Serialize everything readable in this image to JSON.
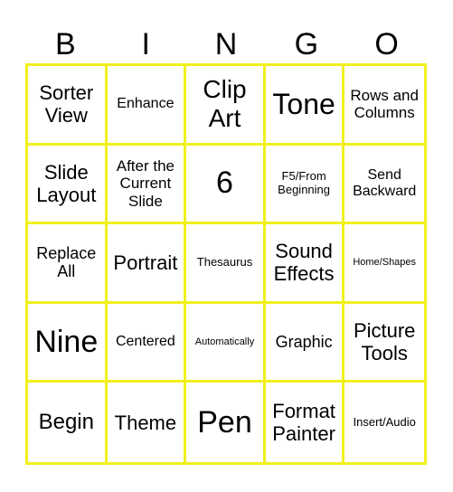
{
  "header": {
    "letters": [
      "B",
      "I",
      "N",
      "G",
      "O"
    ]
  },
  "colors": {
    "grid_border": "#f0f01e",
    "background": "#ffffff",
    "text": "#000000"
  },
  "cells": [
    "Sorter View",
    "Enhance",
    "Clip Art",
    "Tone",
    "Rows and Columns",
    "Slide Layout",
    "After the Current Slide",
    "6",
    "F5/From Beginning",
    "Send Backward",
    "Replace All",
    "Portrait",
    "Thesaurus",
    "Sound Effects",
    "Home/Shapes",
    "Nine",
    "Centered",
    "Automatically",
    "Graphic",
    "Picture Tools",
    "Begin",
    "Theme",
    "Pen",
    "Format Painter",
    "Insert/Audio"
  ]
}
